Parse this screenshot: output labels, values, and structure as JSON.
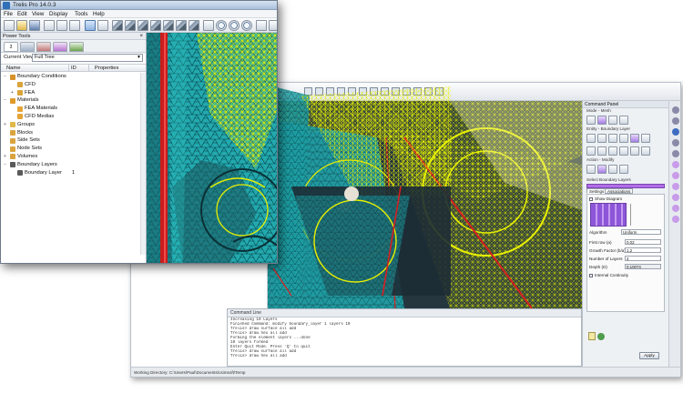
{
  "app": {
    "title": "Trelis Pro 14.0.3"
  },
  "menu": [
    "File",
    "Edit",
    "View",
    "Display",
    "Tools",
    "Help"
  ],
  "toolbar": {
    "icons": [
      "new-file",
      "open-folder",
      "save",
      "undo",
      "redo",
      "cut",
      "select-arrow",
      "select-cursor",
      "cube-vertex",
      "cube-curve",
      "cube-surface",
      "cube-volume",
      "cube-group",
      "cube-body",
      "cube-mesh",
      "zoom-in",
      "zoom-out",
      "zoom-fit",
      "zoom-box",
      "rotate-view"
    ]
  },
  "power_tools": {
    "title": "Power Tools",
    "close": "×",
    "tabs": [
      "3",
      "",
      "",
      "",
      ""
    ],
    "current_view_label": "Current View",
    "current_view_value": "Full Tree",
    "columns": {
      "name": "Name",
      "id": "ID",
      "properties": "Properties"
    },
    "tree": [
      {
        "level": 0,
        "expand": "−",
        "label": "Boundary Conditions",
        "icon": "boundary-conditions-icon",
        "color": "#d8902a",
        "id": ""
      },
      {
        "level": 1,
        "expand": "",
        "label": "CFD",
        "icon": "cfd-icon",
        "color": "#d8a43a",
        "id": ""
      },
      {
        "level": 1,
        "expand": "+",
        "label": "FEA",
        "icon": "fea-icon",
        "color": "#d8a43a",
        "id": ""
      },
      {
        "level": 0,
        "expand": "−",
        "label": "Materials",
        "icon": "materials-icon",
        "color": "#e09a2c",
        "id": ""
      },
      {
        "level": 1,
        "expand": "",
        "label": "FEA Materials",
        "icon": "fea-materials-icon",
        "color": "#e6a437",
        "id": ""
      },
      {
        "level": 1,
        "expand": "",
        "label": "CFD Medias",
        "icon": "cfd-medias-icon",
        "color": "#e6a437",
        "id": ""
      },
      {
        "level": 0,
        "expand": "+",
        "label": "Groups",
        "icon": "groups-icon",
        "color": "#e0b84a",
        "id": ""
      },
      {
        "level": 0,
        "expand": "",
        "label": "Blocks",
        "icon": "blocks-icon",
        "color": "#d9a440",
        "id": ""
      },
      {
        "level": 0,
        "expand": "",
        "label": "Side Sets",
        "icon": "side-sets-icon",
        "color": "#d9a440",
        "id": ""
      },
      {
        "level": 0,
        "expand": "",
        "label": "Node Sets",
        "icon": "node-sets-icon",
        "color": "#d9a440",
        "id": ""
      },
      {
        "level": 0,
        "expand": "+",
        "label": "Volumes",
        "icon": "volumes-icon",
        "color": "#d9a440",
        "id": ""
      },
      {
        "level": 0,
        "expand": "−",
        "label": "Boundary Layers",
        "icon": "boundary-layers-icon",
        "color": "#5a5a5a",
        "id": ""
      },
      {
        "level": 1,
        "expand": "",
        "label": "Boundary Layer",
        "icon": "boundary-layer-icon",
        "color": "#5a5a5a",
        "id": "1"
      }
    ]
  },
  "command_panel": {
    "title": "Command Panel",
    "mode_label": "Mode - Mesh",
    "entity_label": "Entity - Boundary Layer",
    "action_label": "Action - Modify",
    "select_label": "Select Boundary Layers",
    "tabs": [
      "Settings",
      "Associations"
    ],
    "show_diagram": "Show Diagram",
    "fields": [
      {
        "label": "Algorithm",
        "value": "Uniform"
      },
      {
        "label": "First row (a)",
        "value": "0.02"
      },
      {
        "label": "Growth Factor (b/a)",
        "value": "1.2"
      },
      {
        "label": "Number of Layers",
        "value": "4"
      },
      {
        "label": "Depth (D)",
        "value": "0.10074"
      }
    ],
    "internal_continuity": "Internal Continuity",
    "apply": "Apply"
  },
  "command_line": {
    "title": "Command Line",
    "lines": [
      "Increasing 10 Layers",
      "Finished Command: modify boundary_layer 1 layers 10",
      "",
      "Trelis> draw surface all add",
      "Trelis> draw hex all add",
      "",
      "Forming the element layers ...done",
      "10 layers formed",
      "Enter Quit Mode. Press 'Q' to quit",
      "Trelis> draw surface all add",
      "Trelis> draw hex all add"
    ],
    "tabs": [
      "Script",
      "Command",
      "Error",
      "History"
    ]
  },
  "status": {
    "working_directory": "Working Directory: C:\\Users\\Paul\\Documents\\csimsoft\\Temp"
  },
  "colors": {
    "mesh_cyan": "#1fa7ad",
    "wire_yellow": "#e6f000",
    "boundary_red": "#d61f1f",
    "viewport_bg": "#2d3d46",
    "selection_purple": "#b06ee6"
  }
}
